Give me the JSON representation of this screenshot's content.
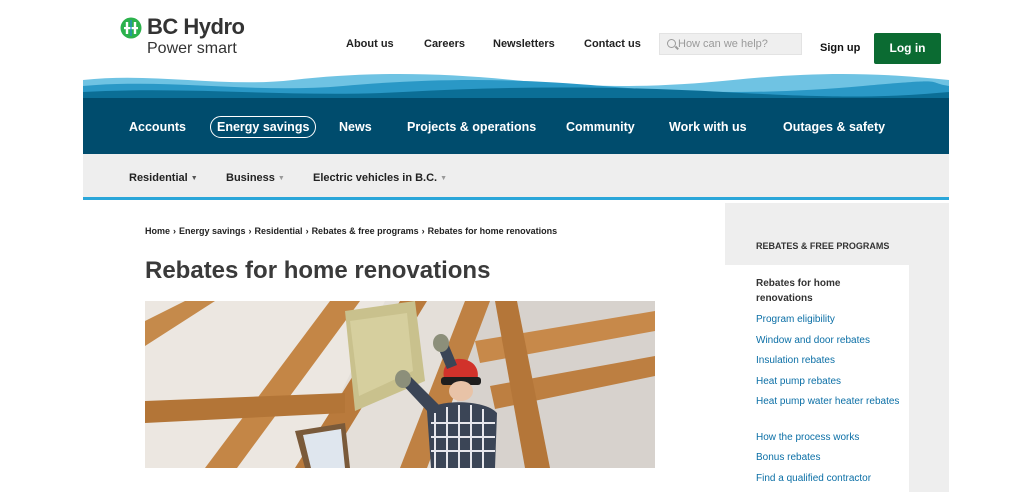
{
  "brand": {
    "name": "BC Hydro",
    "tagline": "Power smart"
  },
  "utility_nav": [
    "About us",
    "Careers",
    "Newsletters",
    "Contact us"
  ],
  "search": {
    "placeholder": "How can we help?"
  },
  "account": {
    "signup_label": "Sign up",
    "login_label": "Log in"
  },
  "main_nav": {
    "items": [
      "Accounts",
      "Energy savings",
      "News",
      "Projects & operations",
      "Community",
      "Work with us",
      "Outages & safety"
    ],
    "active": "Energy savings"
  },
  "sub_nav": [
    "Residential",
    "Business",
    "Electric vehicles in B.C."
  ],
  "breadcrumb": [
    "Home",
    "Energy savings",
    "Residential",
    "Rebates & free programs",
    "Rebates for home renovations"
  ],
  "page": {
    "title": "Rebates for home renovations"
  },
  "side_nav": {
    "heading": "REBATES & FREE PROGRAMS",
    "current": "Rebates for home renovations",
    "links": [
      "Program eligibility",
      "Window and door rebates",
      "Insulation rebates",
      "Heat pump rebates",
      "Heat pump water heater rebates",
      "How the process works",
      "Bonus rebates",
      "Find a qualified contractor"
    ]
  },
  "colors": {
    "nav_blue": "#004c6d",
    "accent_cyan": "#2aa6d9",
    "login_green": "#0b6b32",
    "link_blue": "#0b6fa6"
  }
}
